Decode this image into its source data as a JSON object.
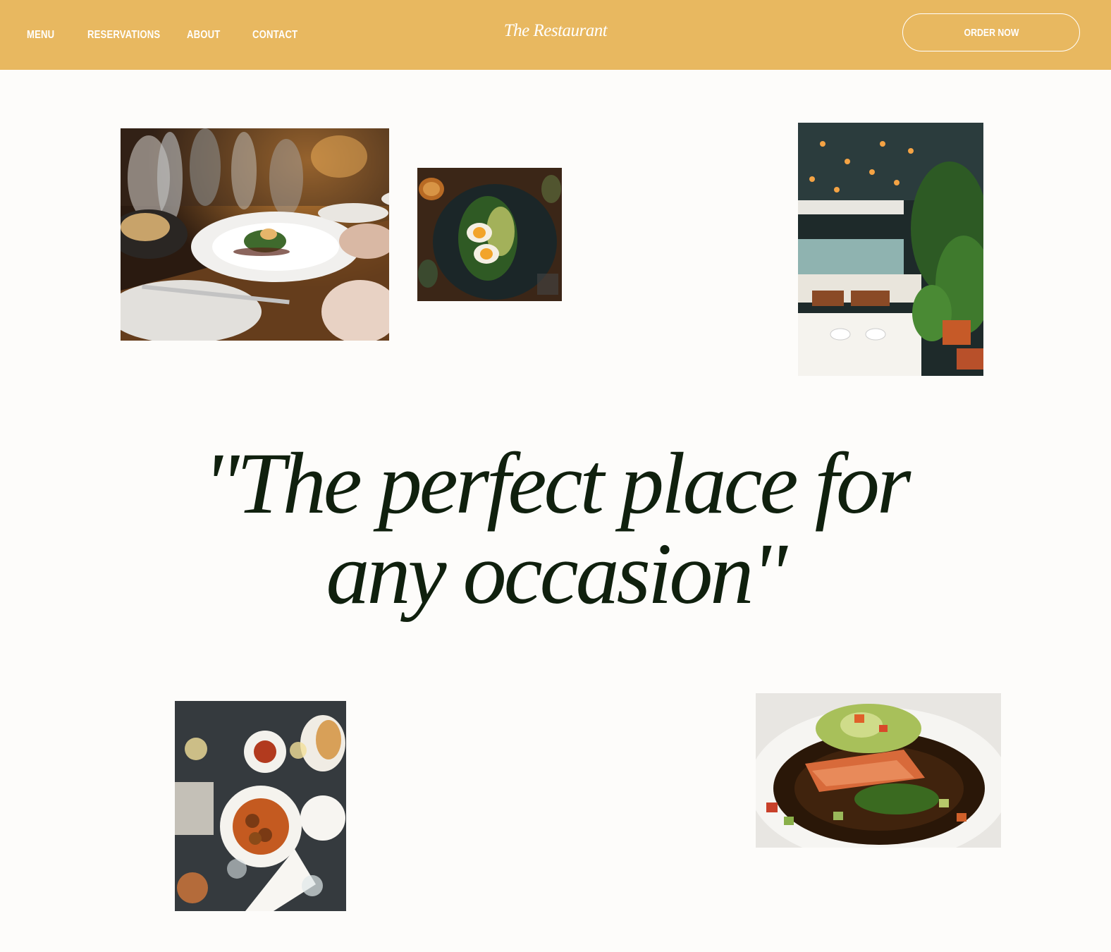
{
  "nav": {
    "links": [
      "MENU",
      "RESERVATIONS",
      "ABOUT",
      "CONTACT"
    ],
    "brand": "The Restaurant",
    "order_label": "ORDER NOW"
  },
  "hero": {
    "quote_line1": "\"The perfect place for",
    "quote_line2": "any occasion\""
  },
  "colors": {
    "accent": "#e8b860",
    "background": "#fdfcfa",
    "headline": "#10200e"
  },
  "photos": [
    {
      "icon": "image-icon",
      "subject": "dinner-table-plated-dish"
    },
    {
      "icon": "image-icon",
      "subject": "egg-avocado-toast"
    },
    {
      "icon": "image-icon",
      "subject": "restaurant-interior-plants"
    },
    {
      "icon": "image-icon",
      "subject": "table-top-meatballs"
    },
    {
      "icon": "image-icon",
      "subject": "salmon-dish"
    }
  ]
}
